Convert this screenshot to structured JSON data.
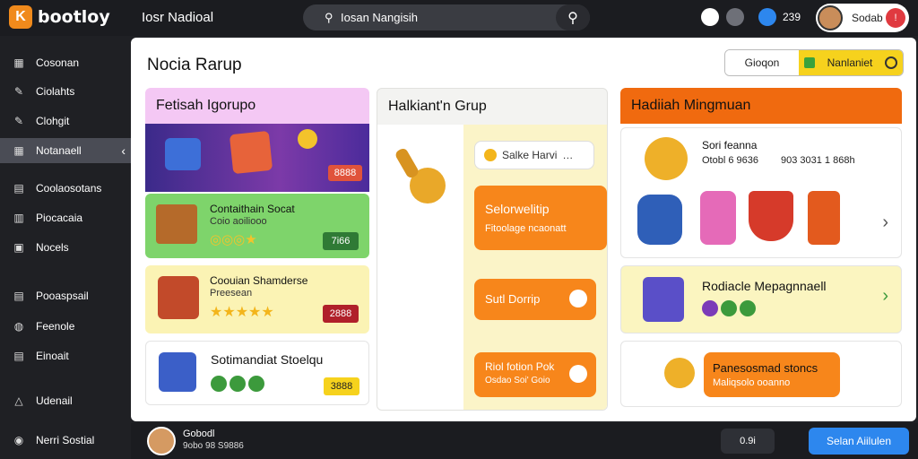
{
  "app": {
    "logo_mark": "K",
    "logo_text": "bootloy",
    "title": "Iosr Nadioal"
  },
  "search": {
    "value": "Iosan Nangisih",
    "search_glyph": "⚲",
    "button_glyph": "⚲"
  },
  "topbar": {
    "count": "239",
    "user_name": "Sodab",
    "badge": "!"
  },
  "sidebar": {
    "items": [
      {
        "label": "Cosonan",
        "icon": "▦"
      },
      {
        "label": "Ciolahts",
        "icon": "✎"
      },
      {
        "label": "Clohgit",
        "icon": "✎"
      },
      {
        "label": "Notanaell",
        "icon": "▦",
        "active": true
      },
      {
        "label": "Coolaosotans",
        "icon": "▤"
      },
      {
        "label": "Piocacaia",
        "icon": "▥"
      },
      {
        "label": "Nocels",
        "icon": "▣"
      },
      {
        "label": "Pooaspsail",
        "icon": "▤"
      },
      {
        "label": "Feenole",
        "icon": "◍"
      },
      {
        "label": "Einoait",
        "icon": "▤"
      },
      {
        "label": "Udenail",
        "icon": "△"
      },
      {
        "label": "Nerri Sostial",
        "icon": "◉"
      }
    ],
    "active_chevron": "‹"
  },
  "page": {
    "title": "Nocia Rarup"
  },
  "segment": {
    "a": "Gioqon",
    "b": "Nanlaniet"
  },
  "col1": {
    "title": "Fetisah Igorupo",
    "banner_price": "8888",
    "cards": [
      {
        "title": "Contaithain Socat",
        "sub": "Coio aoiliooo",
        "coins": "◎◎◎★",
        "price": "7i66"
      },
      {
        "title": "Coouian Shamderse",
        "sub": "Preesean",
        "stars": "★★★★★",
        "price": "2888"
      },
      {
        "title": "Sotimandiat Stoelqu",
        "sub": "",
        "price": "3888"
      }
    ]
  },
  "col2": {
    "title": "Halkiant'n Grup",
    "search_label": "Salke Harvi",
    "search_glyph": "…",
    "btn1_title": "Selorwelitip",
    "btn1_sub": "Fitoolage ncaonatt",
    "btn2_title": "Sutl Dorrip",
    "btn3_title": "Riol fotion Pok",
    "btn3_sub": "Osdao Soi' Goio"
  },
  "col3": {
    "title": "Hadiiah Mingmuan",
    "card1": {
      "name": "Sori feanna",
      "meta_a": "Otobl 6 9636",
      "meta_b": "903 3031 1 868h"
    },
    "card2": {
      "title": "Rodiacle Mepagnnaell"
    },
    "card3": {
      "title": "Panesosmad stoncs",
      "sub": "Maliqsolo ooanno"
    },
    "chevron": "›"
  },
  "bottombar": {
    "name": "Gobodl",
    "sub": "9obo 98 S9886",
    "mid": "0.9i",
    "button": "Selan Aiilulen"
  },
  "colors": {
    "accent": "#f7861b",
    "brand": "#f08a1c",
    "primary_button": "#2d87ee",
    "highlight": "#f6d21d"
  }
}
